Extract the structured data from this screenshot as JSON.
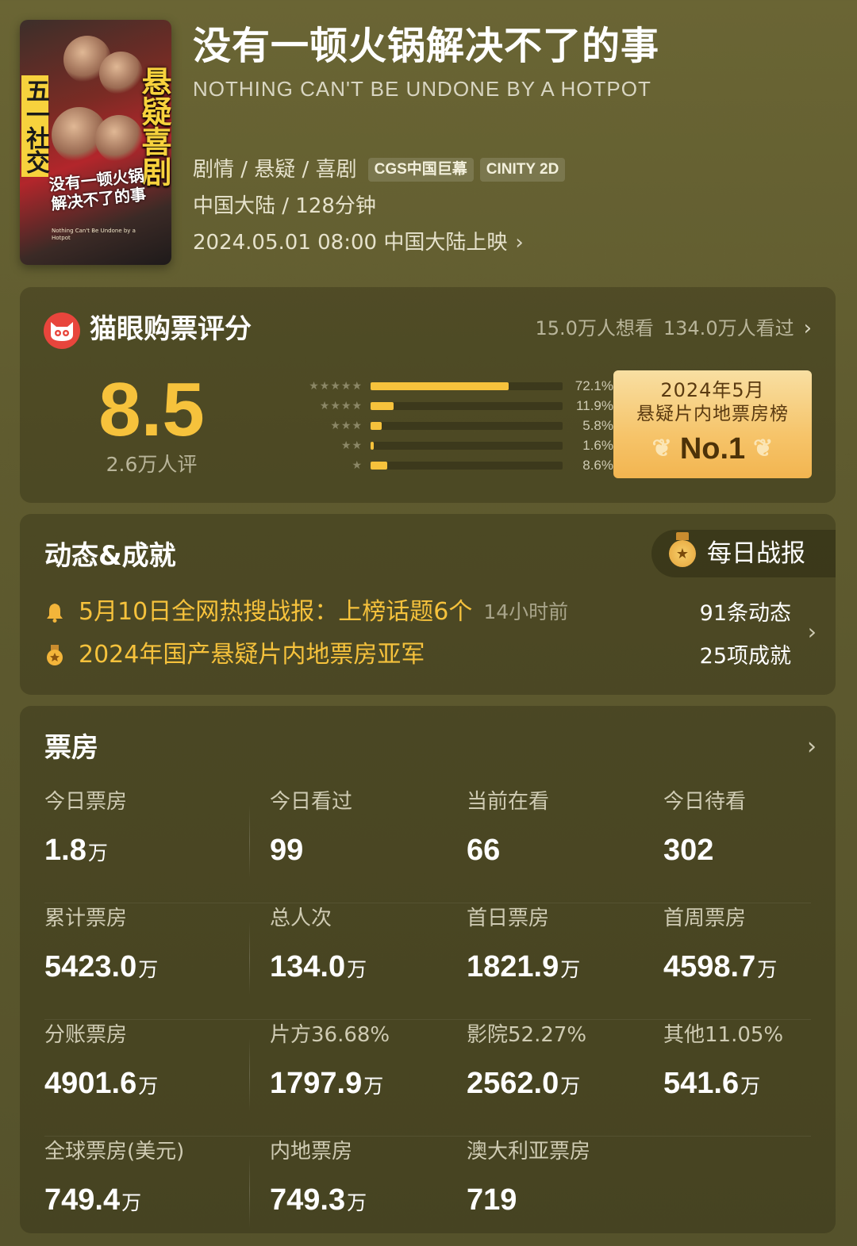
{
  "movie": {
    "poster_tag_left": "五一社交",
    "poster_tag_right": "悬疑喜剧",
    "poster_title": "没有一顿火锅 解决不了的事",
    "poster_sub": "Nothing Can't Be Undone by a Hotpot",
    "title_cn": "没有一顿火锅解决不了的事",
    "title_en": "NOTHING CAN'T BE UNDONE BY A HOTPOT",
    "genres": "剧情 / 悬疑 / 喜剧",
    "formats": [
      "CGS中国巨幕",
      "CINITY 2D"
    ],
    "region_duration": "中国大陆 / 128分钟",
    "release": "2024.05.01 08:00 中国大陆上映"
  },
  "rating": {
    "title": "猫眼购票评分",
    "want_see": "15.0万人想看",
    "seen": "134.0万人看过",
    "score": "8.5",
    "count": "2.6万人评",
    "distribution": [
      {
        "stars": 5,
        "percent": 72.1,
        "label": "72.1%"
      },
      {
        "stars": 4,
        "percent": 11.9,
        "label": "11.9%"
      },
      {
        "stars": 3,
        "percent": 5.8,
        "label": "5.8%"
      },
      {
        "stars": 2,
        "percent": 1.6,
        "label": "1.6%"
      },
      {
        "stars": 1,
        "percent": 8.6,
        "label": "8.6%"
      }
    ],
    "rank_line1": "2024年5月",
    "rank_line2": "悬疑片内地票房榜",
    "rank_line3": "No.1"
  },
  "news": {
    "title": "动态&成就",
    "daily_label": "每日战报",
    "items": [
      {
        "icon": "bell-icon",
        "text": "5月10日全网热搜战报：上榜话题6个",
        "time": "14小时前"
      },
      {
        "icon": "medal-icon",
        "text": "2024年国产悬疑片内地票房亚军",
        "time": ""
      }
    ],
    "dynamics_count": "91条动态",
    "achievements_count": "25项成就"
  },
  "boxoffice": {
    "title": "票房",
    "rows": [
      [
        {
          "label": "今日票房",
          "value": "1.8",
          "unit": "万"
        },
        {
          "label": "今日看过",
          "value": "99",
          "unit": ""
        },
        {
          "label": "当前在看",
          "value": "66",
          "unit": ""
        },
        {
          "label": "今日待看",
          "value": "302",
          "unit": ""
        }
      ],
      [
        {
          "label": "累计票房",
          "value": "5423.0",
          "unit": "万"
        },
        {
          "label": "总人次",
          "value": "134.0",
          "unit": "万"
        },
        {
          "label": "首日票房",
          "value": "1821.9",
          "unit": "万"
        },
        {
          "label": "首周票房",
          "value": "4598.7",
          "unit": "万"
        }
      ],
      [
        {
          "label": "分账票房",
          "value": "4901.6",
          "unit": "万"
        },
        {
          "label": "片方36.68%",
          "value": "1797.9",
          "unit": "万"
        },
        {
          "label": "影院52.27%",
          "value": "2562.0",
          "unit": "万"
        },
        {
          "label": "其他11.05%",
          "value": "541.6",
          "unit": "万"
        }
      ],
      [
        {
          "label": "全球票房(美元)",
          "value": "749.4",
          "unit": "万"
        },
        {
          "label": "内地票房",
          "value": "749.3",
          "unit": "万"
        },
        {
          "label": "澳大利亚票房",
          "value": "719",
          "unit": ""
        }
      ]
    ]
  },
  "colors": {
    "accent": "#f6c23c",
    "background": "#625e31",
    "brand_red": "#e8453c"
  }
}
